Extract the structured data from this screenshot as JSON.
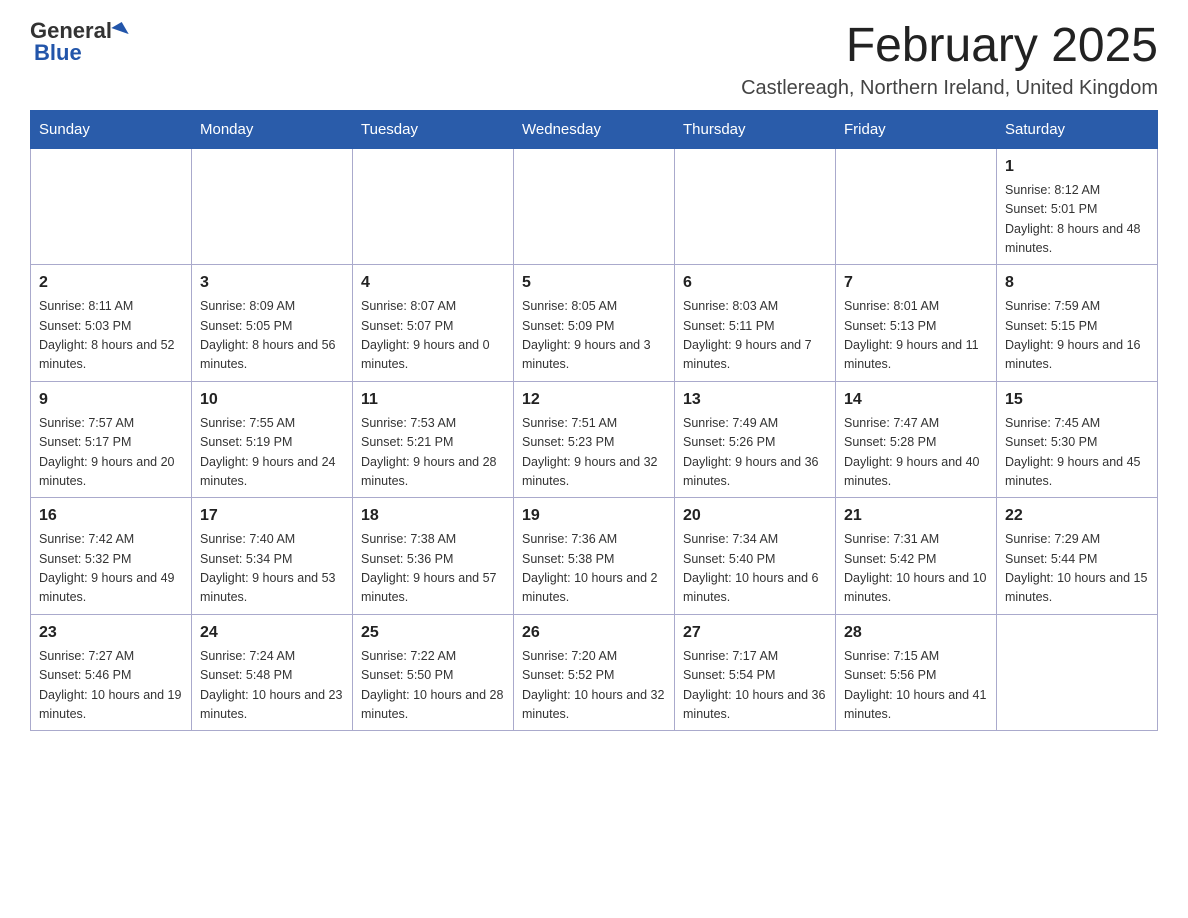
{
  "header": {
    "logo_text_black": "General",
    "logo_text_blue": "Blue",
    "month_title": "February 2025",
    "location": "Castlereagh, Northern Ireland, United Kingdom"
  },
  "days_of_week": [
    "Sunday",
    "Monday",
    "Tuesday",
    "Wednesday",
    "Thursday",
    "Friday",
    "Saturday"
  ],
  "weeks": [
    [
      {
        "day": "",
        "info": ""
      },
      {
        "day": "",
        "info": ""
      },
      {
        "day": "",
        "info": ""
      },
      {
        "day": "",
        "info": ""
      },
      {
        "day": "",
        "info": ""
      },
      {
        "day": "",
        "info": ""
      },
      {
        "day": "1",
        "info": "Sunrise: 8:12 AM\nSunset: 5:01 PM\nDaylight: 8 hours and 48 minutes."
      }
    ],
    [
      {
        "day": "2",
        "info": "Sunrise: 8:11 AM\nSunset: 5:03 PM\nDaylight: 8 hours and 52 minutes."
      },
      {
        "day": "3",
        "info": "Sunrise: 8:09 AM\nSunset: 5:05 PM\nDaylight: 8 hours and 56 minutes."
      },
      {
        "day": "4",
        "info": "Sunrise: 8:07 AM\nSunset: 5:07 PM\nDaylight: 9 hours and 0 minutes."
      },
      {
        "day": "5",
        "info": "Sunrise: 8:05 AM\nSunset: 5:09 PM\nDaylight: 9 hours and 3 minutes."
      },
      {
        "day": "6",
        "info": "Sunrise: 8:03 AM\nSunset: 5:11 PM\nDaylight: 9 hours and 7 minutes."
      },
      {
        "day": "7",
        "info": "Sunrise: 8:01 AM\nSunset: 5:13 PM\nDaylight: 9 hours and 11 minutes."
      },
      {
        "day": "8",
        "info": "Sunrise: 7:59 AM\nSunset: 5:15 PM\nDaylight: 9 hours and 16 minutes."
      }
    ],
    [
      {
        "day": "9",
        "info": "Sunrise: 7:57 AM\nSunset: 5:17 PM\nDaylight: 9 hours and 20 minutes."
      },
      {
        "day": "10",
        "info": "Sunrise: 7:55 AM\nSunset: 5:19 PM\nDaylight: 9 hours and 24 minutes."
      },
      {
        "day": "11",
        "info": "Sunrise: 7:53 AM\nSunset: 5:21 PM\nDaylight: 9 hours and 28 minutes."
      },
      {
        "day": "12",
        "info": "Sunrise: 7:51 AM\nSunset: 5:23 PM\nDaylight: 9 hours and 32 minutes."
      },
      {
        "day": "13",
        "info": "Sunrise: 7:49 AM\nSunset: 5:26 PM\nDaylight: 9 hours and 36 minutes."
      },
      {
        "day": "14",
        "info": "Sunrise: 7:47 AM\nSunset: 5:28 PM\nDaylight: 9 hours and 40 minutes."
      },
      {
        "day": "15",
        "info": "Sunrise: 7:45 AM\nSunset: 5:30 PM\nDaylight: 9 hours and 45 minutes."
      }
    ],
    [
      {
        "day": "16",
        "info": "Sunrise: 7:42 AM\nSunset: 5:32 PM\nDaylight: 9 hours and 49 minutes."
      },
      {
        "day": "17",
        "info": "Sunrise: 7:40 AM\nSunset: 5:34 PM\nDaylight: 9 hours and 53 minutes."
      },
      {
        "day": "18",
        "info": "Sunrise: 7:38 AM\nSunset: 5:36 PM\nDaylight: 9 hours and 57 minutes."
      },
      {
        "day": "19",
        "info": "Sunrise: 7:36 AM\nSunset: 5:38 PM\nDaylight: 10 hours and 2 minutes."
      },
      {
        "day": "20",
        "info": "Sunrise: 7:34 AM\nSunset: 5:40 PM\nDaylight: 10 hours and 6 minutes."
      },
      {
        "day": "21",
        "info": "Sunrise: 7:31 AM\nSunset: 5:42 PM\nDaylight: 10 hours and 10 minutes."
      },
      {
        "day": "22",
        "info": "Sunrise: 7:29 AM\nSunset: 5:44 PM\nDaylight: 10 hours and 15 minutes."
      }
    ],
    [
      {
        "day": "23",
        "info": "Sunrise: 7:27 AM\nSunset: 5:46 PM\nDaylight: 10 hours and 19 minutes."
      },
      {
        "day": "24",
        "info": "Sunrise: 7:24 AM\nSunset: 5:48 PM\nDaylight: 10 hours and 23 minutes."
      },
      {
        "day": "25",
        "info": "Sunrise: 7:22 AM\nSunset: 5:50 PM\nDaylight: 10 hours and 28 minutes."
      },
      {
        "day": "26",
        "info": "Sunrise: 7:20 AM\nSunset: 5:52 PM\nDaylight: 10 hours and 32 minutes."
      },
      {
        "day": "27",
        "info": "Sunrise: 7:17 AM\nSunset: 5:54 PM\nDaylight: 10 hours and 36 minutes."
      },
      {
        "day": "28",
        "info": "Sunrise: 7:15 AM\nSunset: 5:56 PM\nDaylight: 10 hours and 41 minutes."
      },
      {
        "day": "",
        "info": ""
      }
    ]
  ]
}
